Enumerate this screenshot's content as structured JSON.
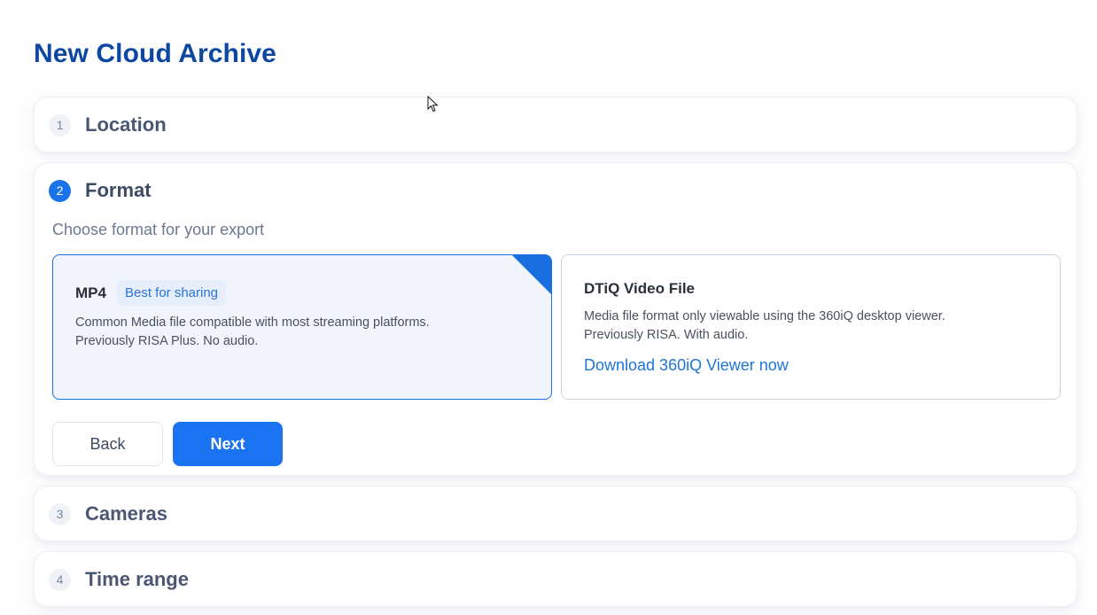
{
  "page": {
    "title": "New Cloud Archive"
  },
  "steps": [
    {
      "number": "1",
      "title": "Location",
      "state": "inactive"
    },
    {
      "number": "2",
      "title": "Format",
      "state": "active"
    },
    {
      "number": "3",
      "title": "Cameras",
      "state": "inactive"
    },
    {
      "number": "4",
      "title": "Time range",
      "state": "inactive"
    }
  ],
  "format_step": {
    "subtitle": "Choose format for your export",
    "options": [
      {
        "name": "MP4",
        "badge": "Best for sharing",
        "description_line1": "Common Media file compatible with most streaming platforms.",
        "description_line2": "Previously RISA Plus. No audio.",
        "selected": true
      },
      {
        "name": "DTiQ Video File",
        "description_line1": "Media file format only viewable using the 360iQ desktop viewer.",
        "description_line2": "Previously RISA. With audio.",
        "link": "Download 360iQ Viewer now",
        "selected": false
      }
    ],
    "back_label": "Back",
    "next_label": "Next"
  },
  "colors": {
    "accent": "#1a73e8",
    "title": "#0d47a1",
    "link": "#1f74d6"
  },
  "icons": {
    "cursor": "mouse-pointer-icon"
  }
}
